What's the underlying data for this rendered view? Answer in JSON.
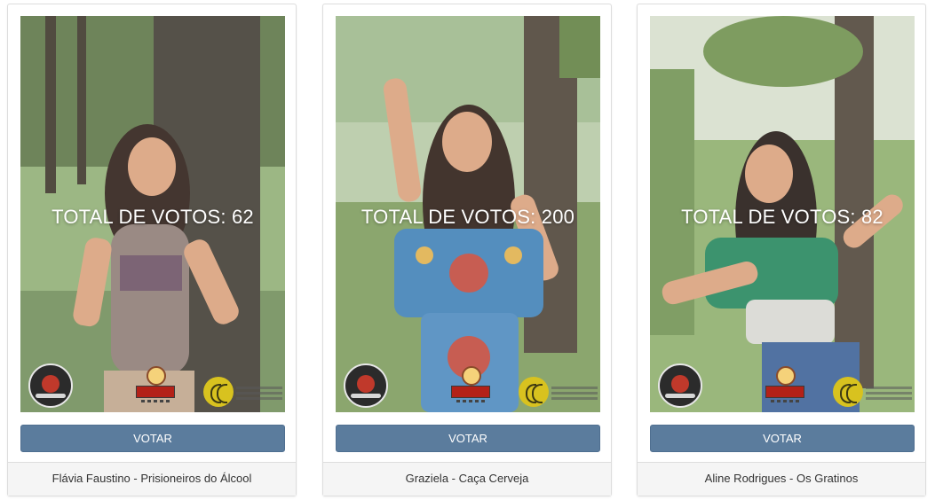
{
  "cards": [
    {
      "votes_text": "TOTAL DE VOTOS: 62",
      "vote_button": "VOTAR",
      "caption": "Flávia Faustino - Prisioneiros do Álcool",
      "photo_colors": {
        "background": "#6f8a52",
        "outfit": "#8d7a74",
        "hair": "#2b1b14"
      }
    },
    {
      "votes_text": "TOTAL DE VOTOS: 200",
      "vote_button": "VOTAR",
      "caption": "Graziela - Caça Cerveja",
      "photo_colors": {
        "background": "#7f9b5e",
        "outfit": "#3d7fb5",
        "hair": "#2a1a12"
      }
    },
    {
      "votes_text": "TOTAL DE VOTOS: 82",
      "vote_button": "VOTAR",
      "caption": "Aline Rodrigues - Os Gratinos",
      "photo_colors": {
        "background": "#8cad6a",
        "outfit": "#22845a",
        "hair": "#1f1510"
      }
    }
  ],
  "colors": {
    "button": "#5b7c9d",
    "footer_background": "#f5f5f5",
    "card_border": "#dddddd"
  }
}
